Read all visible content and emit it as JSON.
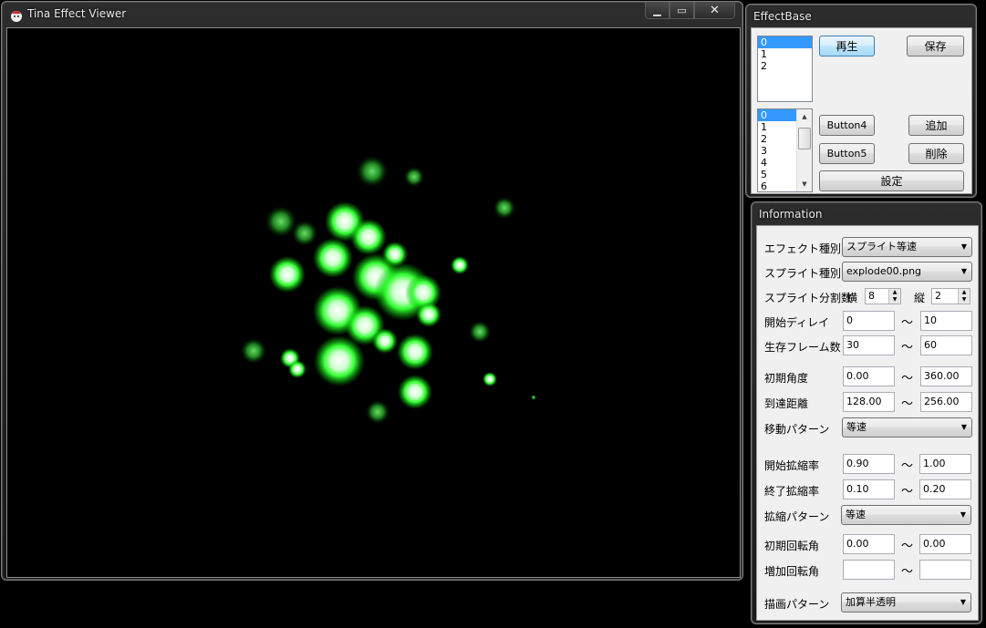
{
  "viewer": {
    "title": "Tina Effect Viewer",
    "min_icon": "minimize-icon",
    "max_icon": "maximize-icon",
    "close_icon": "close-icon",
    "canvas_bg": "#000000",
    "particle_color": "#33ff33"
  },
  "effectbase": {
    "title": "EffectBase",
    "list1": [
      "0",
      "1",
      "2"
    ],
    "list2": [
      "0",
      "1",
      "2",
      "3",
      "4",
      "5",
      "6"
    ],
    "play_label": "再生",
    "save_label": "保存",
    "button4_label": "Button4",
    "add_label": "追加",
    "button5_label": "Button5",
    "delete_label": "削除",
    "settings_label": "設定"
  },
  "information": {
    "title": "Information",
    "tilde": "～",
    "effect_type": {
      "label": "エフェクト種別",
      "value": "スプライト等速"
    },
    "sprite_type": {
      "label": "スプライト種別",
      "value": "explode00.png"
    },
    "sprite_div": {
      "label": "スプライト分割数",
      "h_label": "横",
      "h_value": "8",
      "v_label": "縦",
      "v_value": "2"
    },
    "start_delay": {
      "label": "開始ディレイ",
      "min": "0",
      "max": "10"
    },
    "life_frames": {
      "label": "生存フレーム数",
      "min": "30",
      "max": "60"
    },
    "init_angle": {
      "label": "初期角度",
      "min": "0.00",
      "max": "360.00"
    },
    "reach_dist": {
      "label": "到達距離",
      "min": "128.00",
      "max": "256.00"
    },
    "move_pattern": {
      "label": "移動パターン",
      "value": "等速"
    },
    "start_scale": {
      "label": "開始拡縮率",
      "min": "0.90",
      "max": "1.00"
    },
    "end_scale": {
      "label": "終了拡縮率",
      "min": "0.10",
      "max": "0.20"
    },
    "scale_pattern": {
      "label": "拡縮パターン",
      "value": "等速"
    },
    "init_rotation": {
      "label": "初期回転角",
      "min": "0.00",
      "max": "0.00"
    },
    "add_rotation": {
      "label": "増加回転角",
      "min": "",
      "max": ""
    },
    "draw_pattern": {
      "label": "描画パターン",
      "value": "加算半透明"
    }
  }
}
